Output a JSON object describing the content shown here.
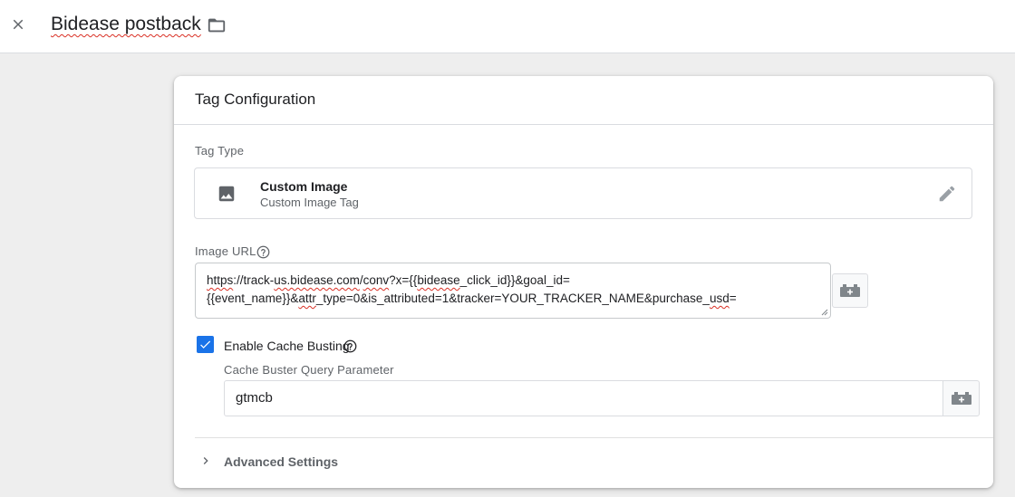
{
  "header": {
    "tag_name": "Bidease postback",
    "icons": {
      "close": "close-icon",
      "folder": "folder-icon"
    }
  },
  "card": {
    "title": "Tag Configuration",
    "tag_type": {
      "label": "Tag Type",
      "name": "Custom Image",
      "description": "Custom Image Tag",
      "icons": {
        "type": "image-icon",
        "edit": "pencil-icon"
      }
    },
    "image_url": {
      "label": "Image URL",
      "line1": {
        "p1": "https",
        "p2": "://track-",
        "p3": "us.bidease.com",
        "p4": "/",
        "p5": "conv",
        "p6": "?x={{",
        "p7": "bidease",
        "p8": "_click_id}}&goal_id="
      },
      "line2": {
        "p1": "{{event_name}}&",
        "p2": "attr",
        "p3": "_type=0&is_attributed=1&tracker=YOUR_TRACKER_NAME&purchase_",
        "p4": "usd",
        "p5": "="
      }
    },
    "cache_busting": {
      "checked": true,
      "label": "Enable Cache Busting",
      "param_label": "Cache Buster Query Parameter",
      "param_value": "gtmcb"
    },
    "advanced": {
      "label": "Advanced Settings"
    }
  },
  "colors": {
    "accent": "#1a73e8",
    "spellcheck": "#d93025",
    "icon": "#5f6368",
    "background": "#eeeeee"
  }
}
